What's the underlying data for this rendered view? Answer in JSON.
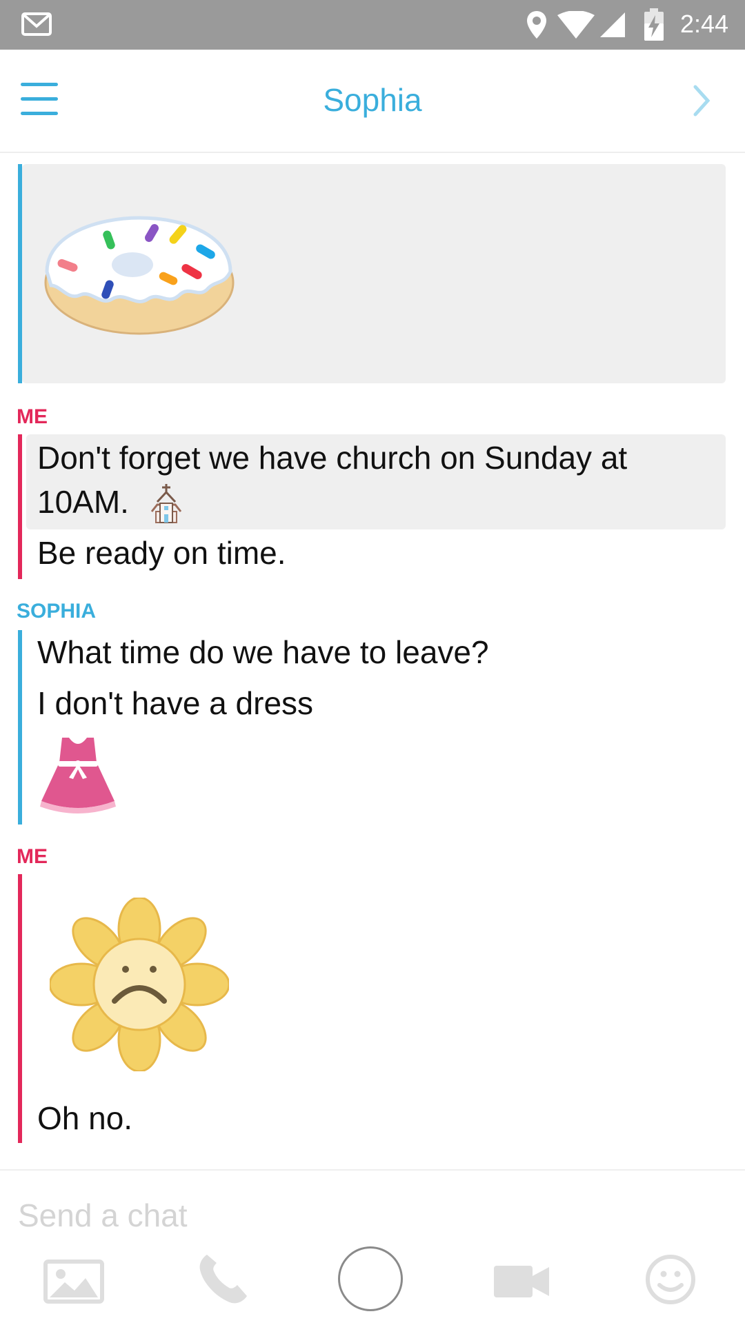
{
  "status_bar": {
    "time": "2:44",
    "icons": [
      "gmail-icon",
      "location-icon",
      "wifi-icon",
      "signal-icon",
      "battery-charging-icon"
    ]
  },
  "header": {
    "title": "Sophia",
    "left_icon": "hamburger-menu-icon",
    "right_icon": "chevron-right-icon"
  },
  "messages": [
    {
      "sender": "",
      "type": "sticker",
      "sticker": "donut-sticker"
    },
    {
      "sender": "ME",
      "lines": [
        "Don't forget we have church on Sunday at",
        "10AM."
      ],
      "emoji": "church-emoji"
    },
    {
      "sender": "",
      "lines": [
        "Be ready on time."
      ]
    },
    {
      "sender": "SOPHIA",
      "lines": [
        "What time do we have to leave?"
      ]
    },
    {
      "sender": "",
      "lines": [
        "I don't have a dress"
      ],
      "emoji": "dress-emoji"
    },
    {
      "sender": "ME",
      "type": "sticker",
      "sticker": "sad-flower-sticker"
    },
    {
      "sender": "",
      "lines": [
        "Oh no."
      ]
    }
  ],
  "input": {
    "placeholder": "Send a chat",
    "value": ""
  },
  "toolbar": [
    "image-icon",
    "phone-icon",
    "capture-button",
    "video-icon",
    "emoji-icon"
  ],
  "colors": {
    "me": "#e3285a",
    "friend": "#3aaedc",
    "highlight": "#efefef"
  }
}
